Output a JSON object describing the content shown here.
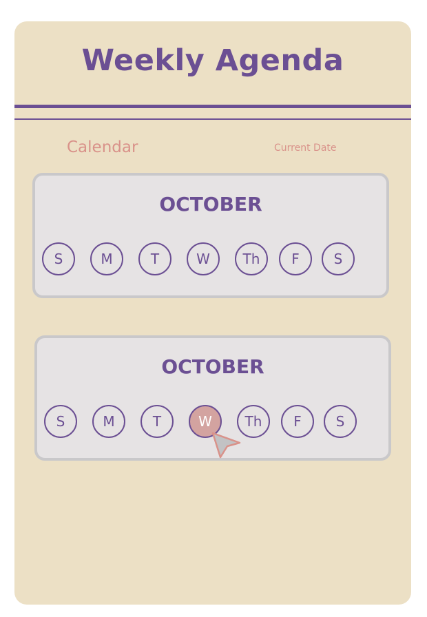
{
  "header": {
    "title": "Weekly Agenda"
  },
  "section": {
    "label": "Calendar",
    "current_date_label": "Current Date"
  },
  "calendars": [
    {
      "month": "OCTOBER",
      "days": [
        "S",
        "M",
        "T",
        "W",
        "Th",
        "F",
        "S"
      ],
      "selected_index": null
    },
    {
      "month": "OCTOBER",
      "days": [
        "S",
        "M",
        "T",
        "W",
        "Th",
        "F",
        "S"
      ],
      "selected_index": 3
    }
  ],
  "colors": {
    "background": "#ece0c5",
    "accent": "#6b4f93",
    "label": "#d9928a",
    "panel": "#e6e3e4",
    "selected": "#d3a3a0"
  },
  "cursor_icon": "mouse-pointer-icon"
}
